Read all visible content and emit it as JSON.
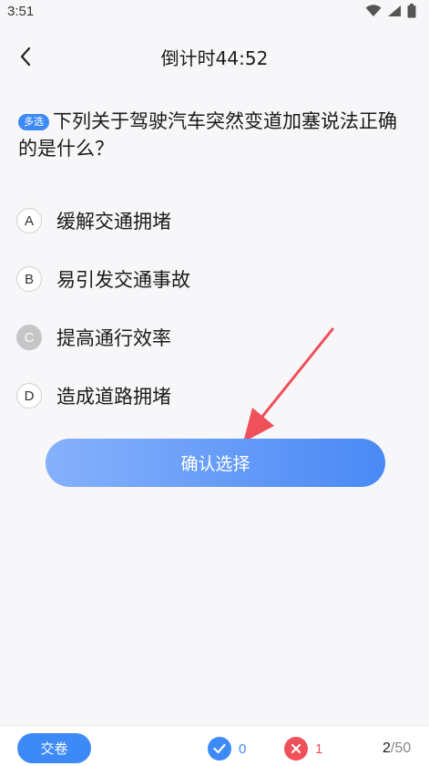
{
  "status": {
    "time": "3:51",
    "icons": [
      "wifi-icon",
      "signal-icon",
      "battery-icon"
    ]
  },
  "header": {
    "title": "倒计时44:52",
    "back_icon": "chevron-left-icon"
  },
  "question": {
    "tag": "多选",
    "text": "下列关于驾驶汽车突然变道加塞说法正确的是什么？"
  },
  "options": [
    {
      "letter": "A",
      "text": "缓解交通拥堵",
      "selected": false
    },
    {
      "letter": "B",
      "text": "易引发交通事故",
      "selected": false
    },
    {
      "letter": "C",
      "text": "提高通行效率",
      "selected": true
    },
    {
      "letter": "D",
      "text": "造成道路拥堵",
      "selected": false
    }
  ],
  "confirm_label": "确认选择",
  "footer": {
    "submit_label": "交卷",
    "correct_count": "0",
    "wrong_count": "1",
    "progress_current": "2",
    "progress_total": "/50"
  },
  "colors": {
    "accent": "#3d8af7",
    "wrong": "#f0505a",
    "arrow": "#f0505a"
  }
}
